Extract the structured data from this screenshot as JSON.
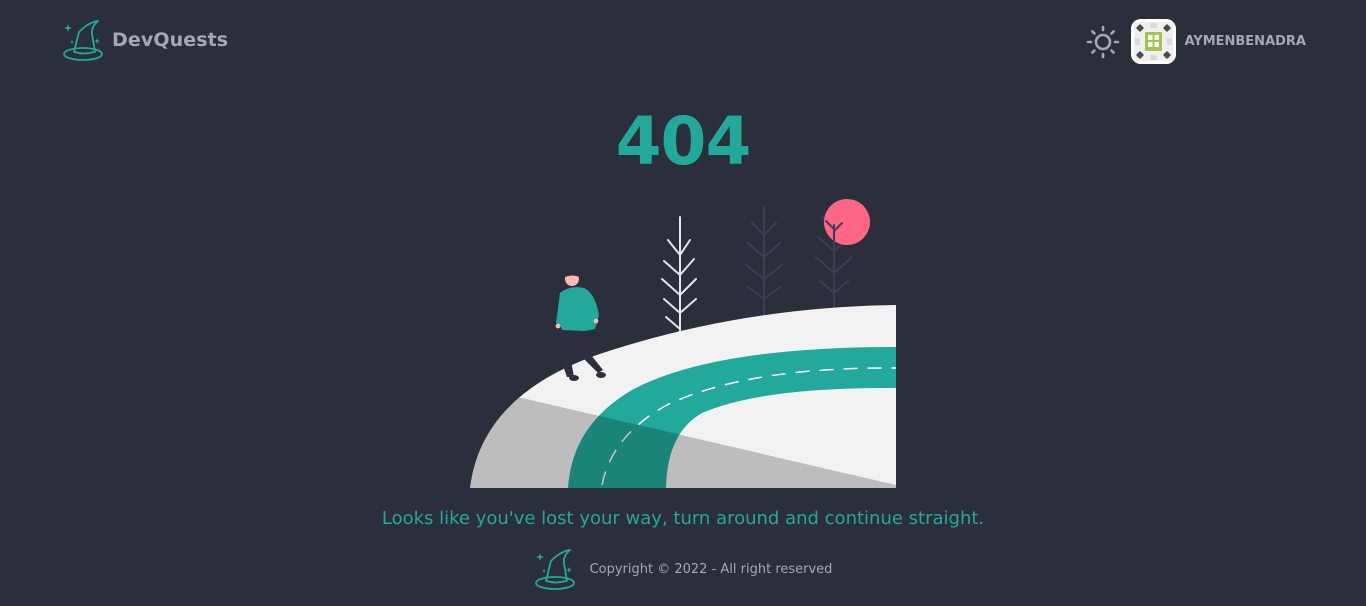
{
  "header": {
    "brand_name": "DevQuests",
    "logo_icon": "wizard-hat-icon",
    "theme_icon": "sun-icon",
    "username": "AYMENBENADRA"
  },
  "main": {
    "error_code": "404",
    "message": "Looks like you've lost your way, turn around and continue straight."
  },
  "footer": {
    "logo_icon": "wizard-hat-icon",
    "copyright": "Copyright © 2022 - All right reserved"
  },
  "colors": {
    "background": "#2b2f3b",
    "accent": "#22a99c",
    "muted_text": "#a3a8b4",
    "sun": "#ff6584"
  }
}
